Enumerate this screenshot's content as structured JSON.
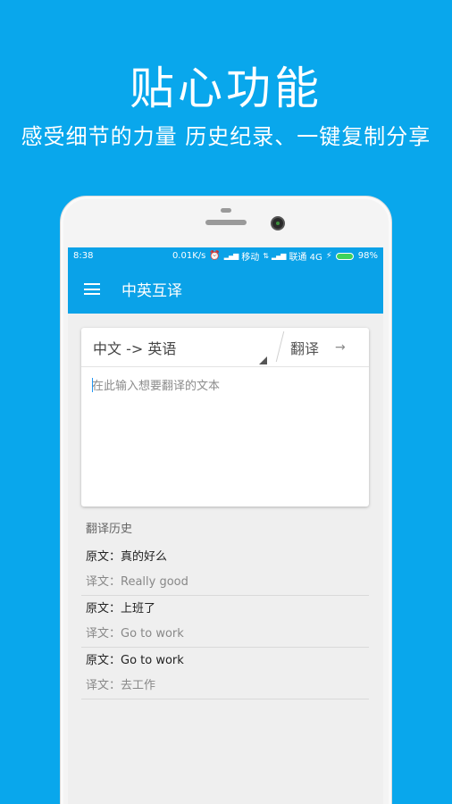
{
  "promo": {
    "title": "贴心功能",
    "subtitle": "感受细节的力量  历史纪录、一键复制分享"
  },
  "status_bar": {
    "time": "8:38",
    "speed": "0.01K/s",
    "carrier1": "移动",
    "carrier2": "联通 4G",
    "battery": "98%"
  },
  "app_bar": {
    "title": "中英互译"
  },
  "translator": {
    "language_pair": "中文 -> 英语",
    "translate_label": "翻译",
    "input_placeholder": "在此输入想要翻译的文本",
    "input_value": ""
  },
  "history": {
    "header": "翻译历史",
    "items": [
      {
        "original": "原文：真的好么",
        "translation": "译文：Really good"
      },
      {
        "original": "原文：上班了",
        "translation": "译文：Go to work"
      },
      {
        "original": "原文：Go to work",
        "translation": "译文：去工作"
      }
    ]
  },
  "colors": {
    "brand_blue": "#09a7ec",
    "toolbar_blue": "#0aa2e8",
    "battery_green": "#3fd25b"
  }
}
